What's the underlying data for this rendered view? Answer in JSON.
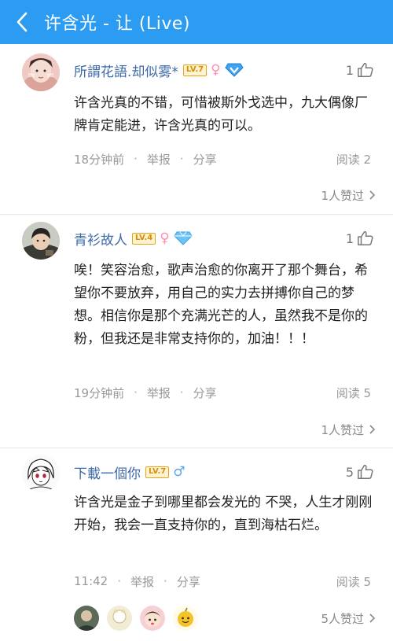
{
  "header": {
    "title": "许含光 - 让 (Live)"
  },
  "comments": [
    {
      "username": "所謂花語.却似雾*",
      "level": "LV.7",
      "gender": "♀",
      "likes": "1",
      "text": "许含光真的不错，可惜被斯外戈选中，九大偶像厂牌肯定能进，许含光真的可以。",
      "time": "18分钟前",
      "report": "举报",
      "share": "分享",
      "reads": "阅读 2",
      "likers": "1人赞过"
    },
    {
      "username": "青衫故人",
      "level": "LV.4",
      "gender": "♀",
      "likes": "1",
      "text": "唉！笑容治愈，歌声治愈的你离开了那个舞台，希望你不要放弃，用自己的实力去拼搏你自己的梦想。相信你是那个充满光芒的人，虽然我不是你的粉，但我还是非常支持你的，加油！！！",
      "time": "19分钟前",
      "report": "举报",
      "share": "分享",
      "reads": "阅读 5",
      "likers": "1人赞过"
    },
    {
      "username": "下載一個你",
      "level": "LV.7",
      "gender": "♂",
      "likes": "5",
      "text": "许含光是金子到哪里都会发光的 不哭，人生才刚刚开始，我会一直支持你的，直到海枯石烂。",
      "time": "11:42",
      "report": "举报",
      "share": "分享",
      "reads": "阅读 5",
      "likers": "5人赞过"
    }
  ],
  "colors": {
    "header_bg": "#2b9cf2",
    "username": "#3d6aa8",
    "level_badge": "#e0a51a",
    "female": "#ff8fb1",
    "male": "#5aa6ee"
  }
}
